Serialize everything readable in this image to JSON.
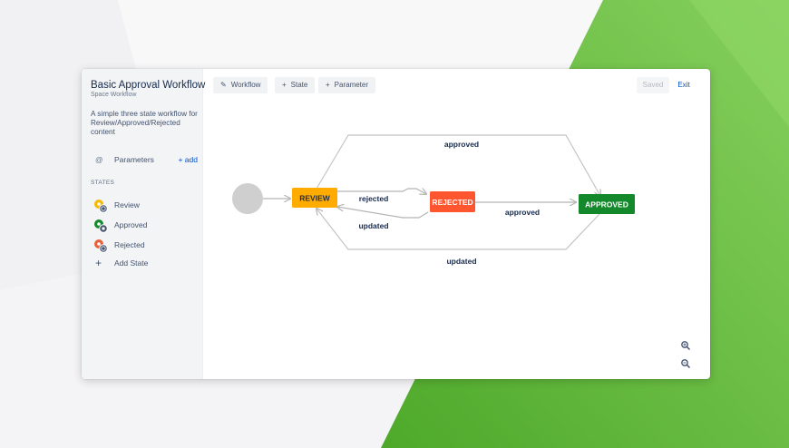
{
  "workflow": {
    "title": "Basic Approval Workflow",
    "subtitle": "Space Workflow",
    "description": "A simple three state workflow for Review/Approved/Rejected content"
  },
  "parameters": {
    "label": "Parameters",
    "add_label": "+ add",
    "icon": "at-icon"
  },
  "states_heading": "STATES",
  "states": [
    {
      "label": "Review",
      "color": "#f6b800",
      "icon": "state-review-icon"
    },
    {
      "label": "Approved",
      "color": "#14892c",
      "icon": "state-approved-icon"
    },
    {
      "label": "Rejected",
      "color": "#e8613c",
      "icon": "state-rejected-icon"
    }
  ],
  "add_state_label": "Add State",
  "toolbar": {
    "workflow_label": "Workflow",
    "state_label": "State",
    "parameter_label": "Parameter",
    "saved_label": "Saved",
    "exit_label": "Exit"
  },
  "diagram": {
    "nodes": {
      "review": {
        "label": "REVIEW",
        "color": "#ffab00"
      },
      "rejected": {
        "label": "REJECTED",
        "color": "#ff5630"
      },
      "approved": {
        "label": "APPROVED",
        "color": "#14892c"
      }
    },
    "transitions": {
      "review_approved": "approved",
      "review_rejected": "rejected",
      "rejected_review": "updated",
      "rejected_approved": "approved",
      "approved_review": "updated"
    }
  },
  "colors": {
    "accent": "#0052cc",
    "green_bg": "#6cc04a"
  }
}
